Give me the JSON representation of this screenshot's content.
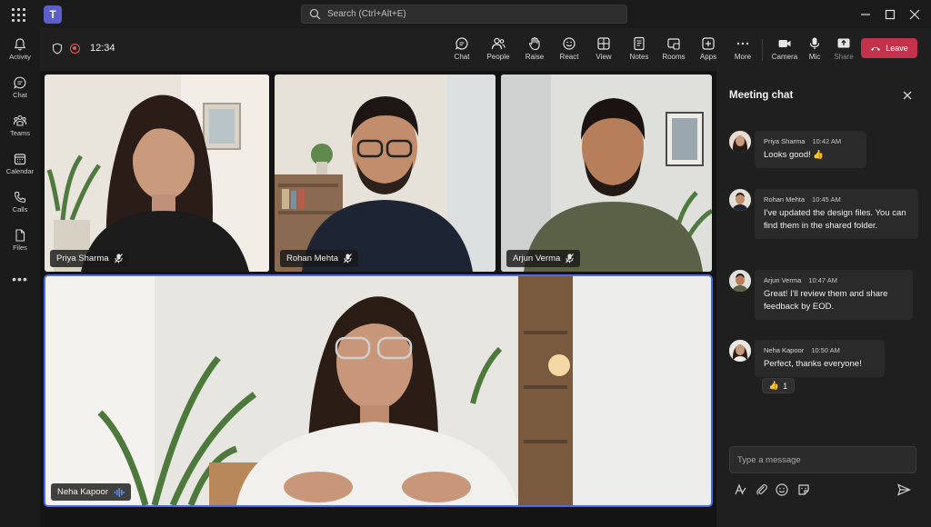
{
  "titlebar": {
    "search_placeholder": "Search (Ctrl+Alt+E)",
    "app_logo_letter": "T",
    "icons": [
      "waffle-icon",
      "teams-logo",
      "search-icon",
      "minimize-icon",
      "maximize-icon",
      "close-icon"
    ]
  },
  "rail": {
    "items": [
      {
        "label": "Activity",
        "icon": "bell-icon"
      },
      {
        "label": "Chat",
        "icon": "chat-icon"
      },
      {
        "label": "Teams",
        "icon": "teams-icon"
      },
      {
        "label": "Calendar",
        "icon": "calendar-icon"
      },
      {
        "label": "Calls",
        "icon": "phone-icon"
      },
      {
        "label": "Files",
        "icon": "file-icon"
      }
    ],
    "more": "•••"
  },
  "meeting": {
    "timer": "12:34",
    "toolbar": {
      "chat": "Chat",
      "people": "People",
      "raise": "Raise",
      "react": "React",
      "view": "View",
      "notes": "Notes",
      "rooms": "Rooms",
      "apps": "Apps",
      "more": "More",
      "camera": "Camera",
      "mic": "Mic",
      "share": "Share",
      "leave": "Leave"
    },
    "participants": [
      {
        "name": "Priya Sharma",
        "muted": true
      },
      {
        "name": "Rohan Mehta",
        "muted": true
      },
      {
        "name": "Arjun Verma",
        "muted": true
      },
      {
        "name": "Neha Kapoor",
        "speaking": true
      }
    ]
  },
  "chat": {
    "title": "Meeting chat",
    "messages": [
      {
        "author": "Priya Sharma",
        "time": "10:42 AM",
        "text": "Looks good! 👍"
      },
      {
        "author": "Rohan Mehta",
        "time": "10:45 AM",
        "text": "I've updated the design files. You can find them in the shared folder."
      },
      {
        "author": "Arjun Verma",
        "time": "10:47 AM",
        "text": "Great! I'll review them and share feedback by EOD."
      },
      {
        "author": "Neha Kapoor",
        "time": "10:50 AM",
        "text": "Perfect, thanks everyone!"
      }
    ],
    "reaction": {
      "emoji": "👍",
      "count": "1"
    },
    "compose_placeholder": "Type a message",
    "colors": {
      "accent": "#4f6bed",
      "leave": "#c4314b",
      "brand": "#5b5fc7"
    }
  }
}
